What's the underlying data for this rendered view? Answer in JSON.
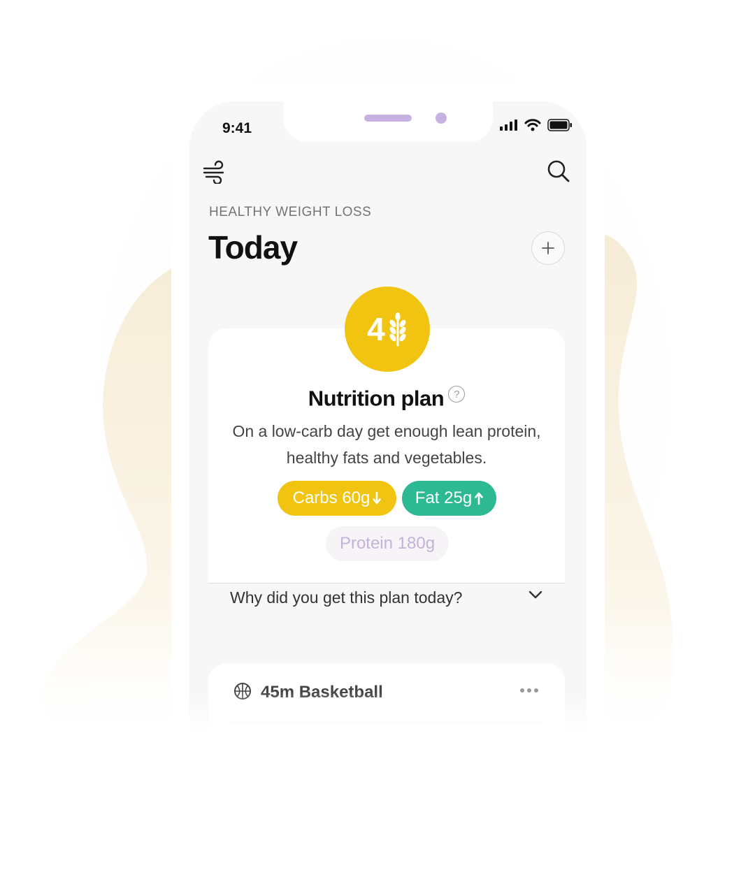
{
  "status_bar": {
    "time": "9:41"
  },
  "header": {
    "eyebrow": "HEALTHY WEIGHT LOSS",
    "title": "Today"
  },
  "icons": {
    "menu": "wind-icon",
    "search": "search-icon",
    "add": "plus-icon",
    "score": "wheat-icon",
    "help": "question-icon",
    "expand": "chevron-down-icon",
    "activity": "basketball-icon",
    "more": "ellipsis-icon"
  },
  "nutrition_plan": {
    "score": "4",
    "title": "Nutrition plan",
    "help_symbol": "?",
    "description": "On a low-carb day get enough lean protein, healthy fats and vegetables.",
    "macros": {
      "carbs": {
        "label": "Carbs 60g",
        "trend": "down"
      },
      "fat": {
        "label": "Fat 25g",
        "trend": "up"
      },
      "protein": {
        "label": "Protein 180g"
      }
    },
    "why_label": "Why did you get this plan today?"
  },
  "activities": [
    {
      "label": "45m Basketball"
    }
  ],
  "colors": {
    "accent_yellow": "#f0c410",
    "accent_green": "#2db992",
    "accent_lavender": "#c7b1e0",
    "background": "#f7f7f7"
  }
}
